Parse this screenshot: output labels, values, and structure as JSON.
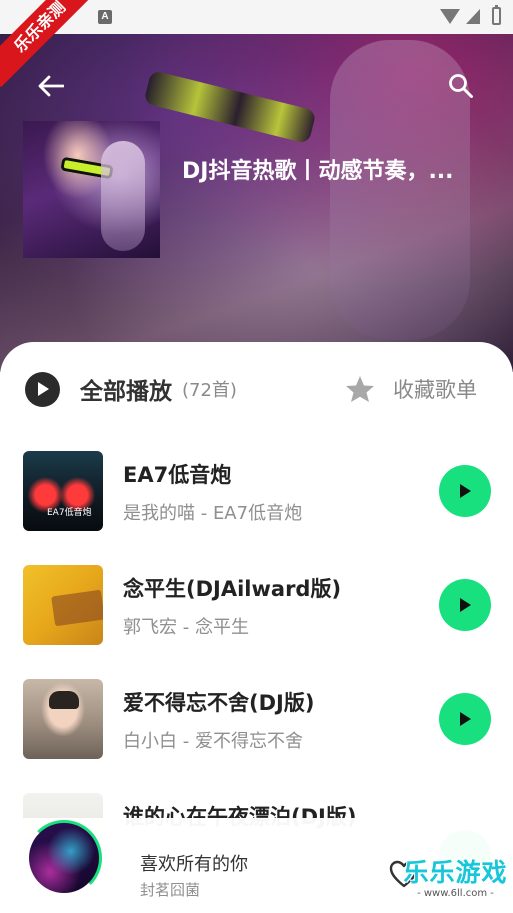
{
  "status_bar": {
    "notification_glyph": "A"
  },
  "watermark_ribbon": "乐乐亲测",
  "header": {
    "back_icon": "back-arrow-icon",
    "search_icon": "search-icon",
    "playlist_title": "DJ抖音热歌丨动感节奏，..."
  },
  "list_header": {
    "play_all_label": "全部播放",
    "count_label": "(72首)",
    "collect_label": "收藏歌单"
  },
  "songs": [
    {
      "title": "EA7低音炮",
      "subtitle": "是我的喵 - EA7低音炮",
      "cover_text": "EA7低音炮"
    },
    {
      "title": "念平生(DJAilward版)",
      "subtitle": "郭飞宏 - 念平生"
    },
    {
      "title": "爱不得忘不舍(DJ版)",
      "subtitle": "白小白 - 爱不得忘不舍"
    },
    {
      "title": "谁的心在午夜漂泊(DJ版)",
      "subtitle": ""
    }
  ],
  "mini_player": {
    "title": "喜欢所有的你",
    "artist": "封茗囧菌"
  },
  "watermark": {
    "big": "乐乐游戏",
    "small": "- www.6ll.com -"
  },
  "colors": {
    "accent": "#19e07f",
    "ribbon": "#d8161c",
    "watermark": "#17c6d9"
  }
}
